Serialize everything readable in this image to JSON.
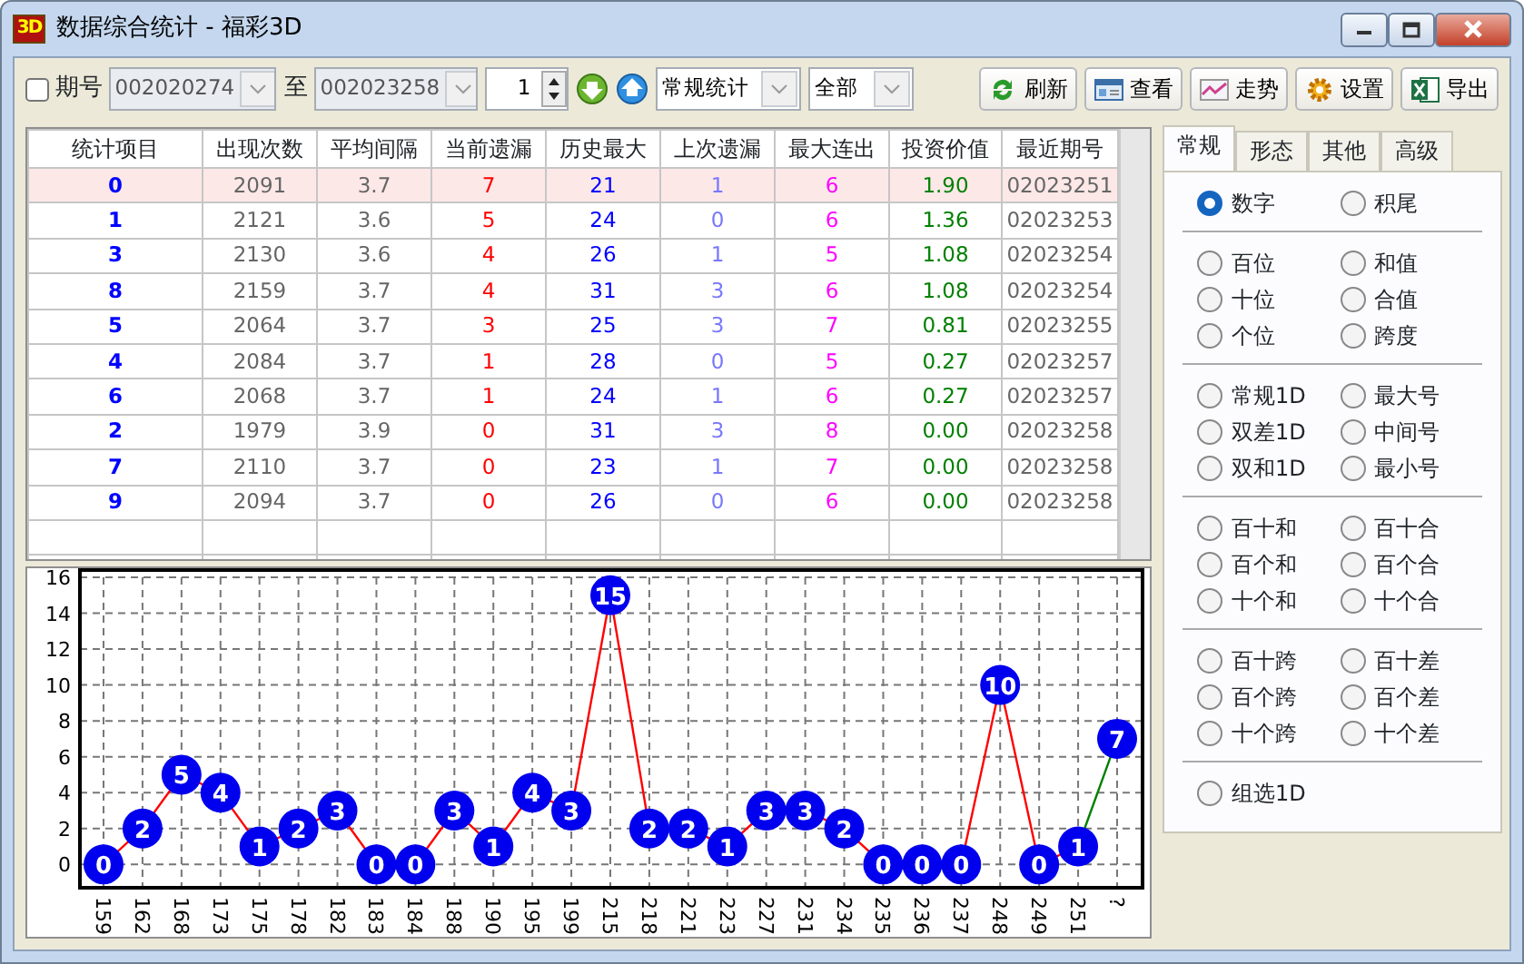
{
  "window": {
    "title": "数据综合统计 - 福彩3D",
    "logo": "3D"
  },
  "toolbar": {
    "period_checkbox": {
      "label": "期号",
      "checked": false
    },
    "from": "002020274",
    "to_label": "至",
    "to": "002023258",
    "spinner": "1",
    "mode": "常规统计",
    "filter": "全部",
    "buttons": [
      {
        "label": "刷新",
        "kind": "refresh"
      },
      {
        "label": "查看",
        "kind": "view"
      },
      {
        "label": "走势",
        "kind": "trend"
      },
      {
        "label": "设置",
        "kind": "settings"
      },
      {
        "label": "导出",
        "kind": "excel"
      }
    ]
  },
  "table": {
    "columns": [
      "统计项目",
      "出现次数",
      "平均间隔",
      "当前遗漏",
      "历史最大",
      "上次遗漏",
      "最大连出",
      "投资价值",
      "最近期号"
    ],
    "rows": [
      {
        "selected": true,
        "cells": [
          "0",
          "2091",
          "3.7",
          "7",
          "21",
          "1",
          "6",
          "1.90",
          "02023251"
        ]
      },
      {
        "selected": false,
        "cells": [
          "1",
          "2121",
          "3.6",
          "5",
          "24",
          "0",
          "6",
          "1.36",
          "02023253"
        ]
      },
      {
        "selected": false,
        "cells": [
          "3",
          "2130",
          "3.6",
          "4",
          "26",
          "1",
          "5",
          "1.08",
          "02023254"
        ]
      },
      {
        "selected": false,
        "cells": [
          "8",
          "2159",
          "3.7",
          "4",
          "31",
          "3",
          "6",
          "1.08",
          "02023254"
        ]
      },
      {
        "selected": false,
        "cells": [
          "5",
          "2064",
          "3.7",
          "3",
          "25",
          "3",
          "7",
          "0.81",
          "02023255"
        ]
      },
      {
        "selected": false,
        "cells": [
          "4",
          "2084",
          "3.7",
          "1",
          "28",
          "0",
          "5",
          "0.27",
          "02023257"
        ]
      },
      {
        "selected": false,
        "cells": [
          "6",
          "2068",
          "3.7",
          "1",
          "24",
          "1",
          "6",
          "0.27",
          "02023257"
        ]
      },
      {
        "selected": false,
        "cells": [
          "2",
          "1979",
          "3.9",
          "0",
          "31",
          "3",
          "8",
          "0.00",
          "02023258"
        ]
      },
      {
        "selected": false,
        "cells": [
          "7",
          "2110",
          "3.7",
          "0",
          "23",
          "1",
          "7",
          "0.00",
          "02023258"
        ]
      },
      {
        "selected": false,
        "cells": [
          "9",
          "2094",
          "3.7",
          "0",
          "26",
          "0",
          "6",
          "0.00",
          "02023258"
        ]
      }
    ]
  },
  "side_panel": {
    "tabs": [
      {
        "label": "常规",
        "selected": true
      },
      {
        "label": "形态",
        "selected": false
      },
      {
        "label": "其他",
        "selected": false
      },
      {
        "label": "高级",
        "selected": false
      }
    ],
    "groups": [
      [
        {
          "label": "数字",
          "selected": true
        },
        {
          "label": "积尾",
          "selected": false
        }
      ],
      [
        {
          "label": "百位",
          "selected": false
        },
        {
          "label": "和值",
          "selected": false
        },
        {
          "label": "十位",
          "selected": false
        },
        {
          "label": "合值",
          "selected": false
        },
        {
          "label": "个位",
          "selected": false
        },
        {
          "label": "跨度",
          "selected": false
        }
      ],
      [
        {
          "label": "常规1D",
          "selected": false
        },
        {
          "label": "最大号",
          "selected": false
        },
        {
          "label": "双差1D",
          "selected": false
        },
        {
          "label": "中间号",
          "selected": false
        },
        {
          "label": "双和1D",
          "selected": false
        },
        {
          "label": "最小号",
          "selected": false
        }
      ],
      [
        {
          "label": "百十和",
          "selected": false
        },
        {
          "label": "百十合",
          "selected": false
        },
        {
          "label": "百个和",
          "selected": false
        },
        {
          "label": "百个合",
          "selected": false
        },
        {
          "label": "十个和",
          "selected": false
        },
        {
          "label": "十个合",
          "selected": false
        }
      ],
      [
        {
          "label": "百十跨",
          "selected": false
        },
        {
          "label": "百十差",
          "selected": false
        },
        {
          "label": "百个跨",
          "selected": false
        },
        {
          "label": "百个差",
          "selected": false
        },
        {
          "label": "十个跨",
          "selected": false
        },
        {
          "label": "十个差",
          "selected": false
        }
      ],
      [
        {
          "label": "组选1D",
          "selected": false
        }
      ]
    ]
  },
  "chart": {
    "chart_data": {
      "type": "line",
      "categories": [
        "159",
        "162",
        "168",
        "173",
        "175",
        "178",
        "182",
        "183",
        "184",
        "188",
        "190",
        "195",
        "199",
        "215",
        "218",
        "221",
        "223",
        "227",
        "231",
        "234",
        "235",
        "236",
        "237",
        "248",
        "249",
        "251",
        "?"
      ],
      "ylim": [
        -1.3,
        16
      ],
      "yticks": [
        0,
        2,
        4,
        6,
        8,
        10,
        12,
        14,
        16
      ],
      "grid": true,
      "series": [
        {
          "color": "#ff0000",
          "marker": "circle",
          "values": [
            0,
            2,
            5,
            4,
            1,
            2,
            3,
            0,
            0,
            3,
            1,
            4,
            3,
            15,
            2,
            2,
            1,
            3,
            3,
            2,
            0,
            0,
            0,
            10,
            0,
            1,
            null
          ],
          "value_labels": [
            "0",
            "2",
            "5",
            "4",
            "1",
            "2",
            "3",
            "0",
            "0",
            "3",
            "1",
            "4",
            "3",
            "15",
            "2",
            "2",
            "1",
            "3",
            "3",
            "2",
            "0",
            "0",
            "0",
            "10",
            "0",
            "1",
            null
          ]
        },
        {
          "color": "#008000",
          "marker": "circle",
          "values": [
            null,
            null,
            null,
            null,
            null,
            null,
            null,
            null,
            null,
            null,
            null,
            null,
            null,
            null,
            null,
            null,
            null,
            null,
            null,
            null,
            null,
            null,
            null,
            null,
            null,
            1,
            7
          ],
          "value_labels": [
            null,
            null,
            null,
            null,
            null,
            null,
            null,
            null,
            null,
            null,
            null,
            null,
            null,
            null,
            null,
            null,
            null,
            null,
            null,
            null,
            null,
            null,
            null,
            null,
            null,
            null,
            "7"
          ]
        }
      ]
    }
  }
}
